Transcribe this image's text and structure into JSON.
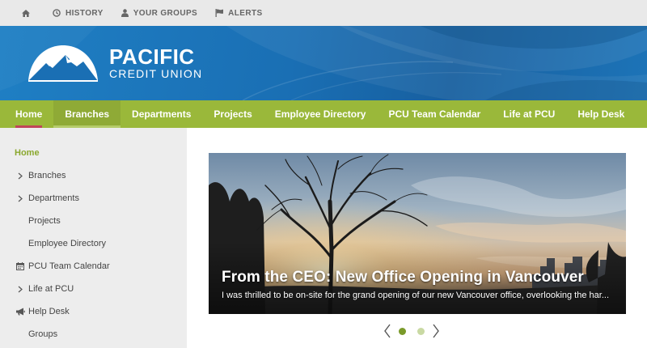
{
  "topbar": {
    "items": [
      {
        "id": "home",
        "label": "",
        "icon": "home-icon"
      },
      {
        "id": "history",
        "label": "HISTORY",
        "icon": "clock-icon"
      },
      {
        "id": "groups",
        "label": "YOUR GROUPS",
        "icon": "user-icon"
      },
      {
        "id": "alerts",
        "label": "ALERTS",
        "icon": "flag-icon"
      }
    ]
  },
  "brand": {
    "name_line1": "PACIFIC",
    "name_line2": "CREDIT UNION"
  },
  "nav": {
    "items": [
      "Home",
      "Branches",
      "Departments",
      "Projects",
      "Employee Directory",
      "PCU Team Calendar",
      "Life at PCU",
      "Help Desk"
    ],
    "active": "Home",
    "hovered": "Branches"
  },
  "sidebar": {
    "items": [
      {
        "label": "Home",
        "marker": "none"
      },
      {
        "label": "Branches",
        "marker": "chevron-right-icon"
      },
      {
        "label": "Departments",
        "marker": "chevron-right-icon"
      },
      {
        "label": "Projects",
        "marker": "none"
      },
      {
        "label": "Employee Directory",
        "marker": "none"
      },
      {
        "label": "PCU Team Calendar",
        "marker": "calendar-icon"
      },
      {
        "label": "Life at PCU",
        "marker": "chevron-right-icon"
      },
      {
        "label": "Help Desk",
        "marker": "megaphone-icon"
      },
      {
        "label": "Groups",
        "marker": "none"
      }
    ]
  },
  "carousel": {
    "title": "From the CEO: New Office Opening in Vancouver",
    "description": "I was thrilled to be on-site for the grand opening of our new Vancouver office, overlooking the har...",
    "slide_count": 2,
    "active_slide": 1
  },
  "colors": {
    "topbar_bg": "#e9e9e9",
    "banner_blue": "#1a6fb4",
    "nav_green": "#9ab83a",
    "active_underline": "#c0455a",
    "sidebar_bg": "#ededed",
    "sidebar_active_text": "#8aa82e",
    "dot_active": "#7a9a2a",
    "dot_inactive": "#c9d9a3"
  }
}
